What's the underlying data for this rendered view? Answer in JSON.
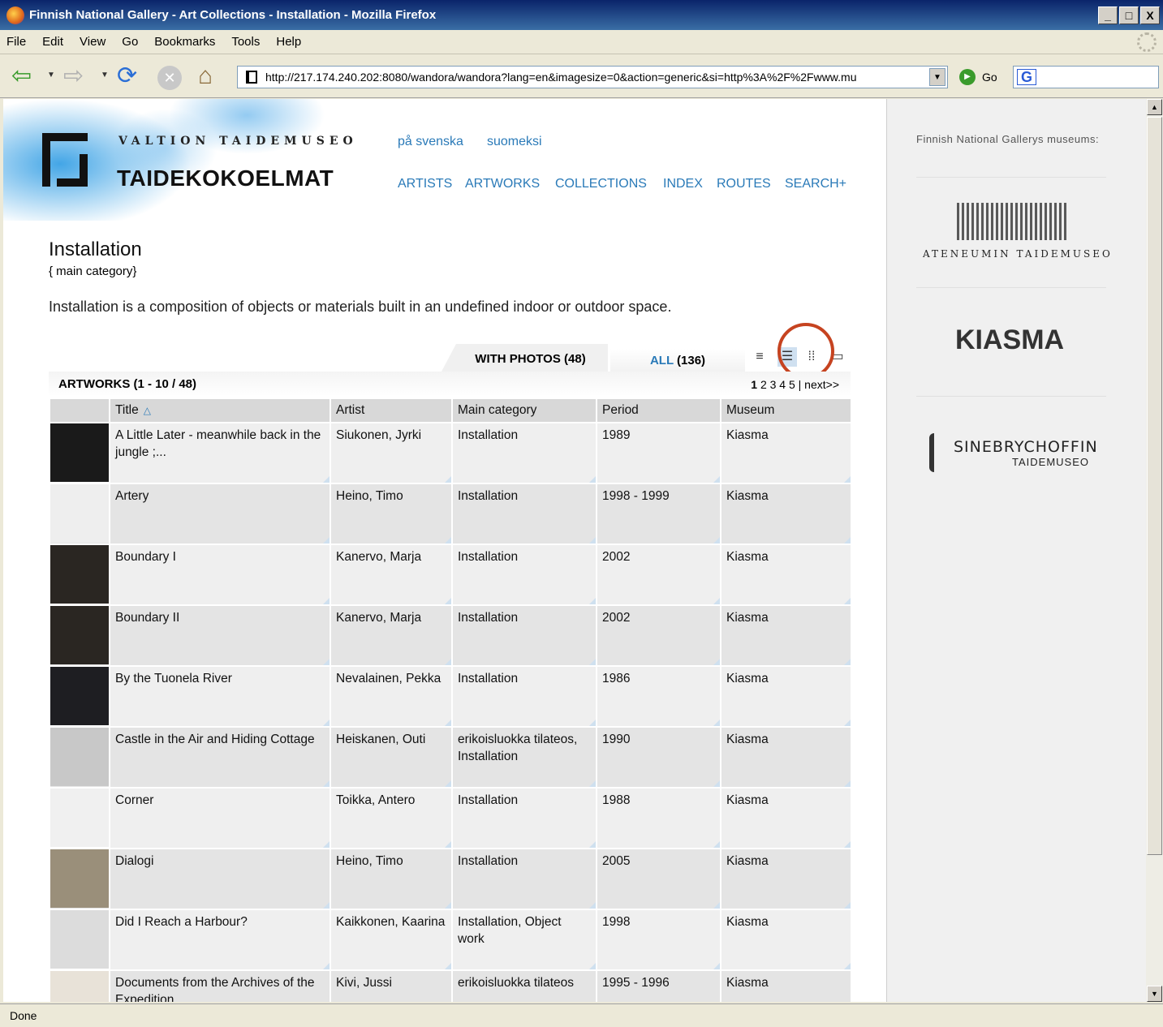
{
  "window": {
    "title": "Finnish National Gallery - Art Collections - Installation - Mozilla Firefox",
    "controls": [
      "_",
      "□",
      "X"
    ]
  },
  "menu": [
    "File",
    "Edit",
    "View",
    "Go",
    "Bookmarks",
    "Tools",
    "Help"
  ],
  "toolbar": {
    "url": "http://217.174.240.202:8080/wandora/wandora?lang=en&imagesize=0&action=generic&si=http%3A%2F%2Fwww.mu",
    "go_label": "Go",
    "search_logo": "G"
  },
  "site": {
    "subtitle": "VALTION TAIDEMUSEO",
    "title": "TAIDEKOKOELMAT",
    "languages": [
      "på svenska",
      "suomeksi"
    ],
    "nav": [
      "ARTISTS",
      "ARTWORKS",
      "COLLECTIONS",
      "INDEX",
      "ROUTES",
      "SEARCH+"
    ]
  },
  "page": {
    "title": "Installation",
    "subtitle": "{  main category}",
    "description": "Installation is a composition of objects or materials built in an undefined indoor or outdoor space."
  },
  "tabs": {
    "photos": "WITH PHOTOS (48)",
    "all_label": "ALL",
    "all_count": " (136)"
  },
  "list_header": {
    "label": "ARTWORKS (1 - 10 / 48)",
    "pager_current": "1",
    "pager_pages": " 2 3 4 5 | next>>"
  },
  "table": {
    "columns": [
      "Title",
      "Artist",
      "Main category",
      "Period",
      "Museum"
    ],
    "rows": [
      {
        "title": "A Little Later - meanwhile back in the jungle ;...",
        "artist": "Siukonen, Jyrki",
        "category": "Installation",
        "period": "1989",
        "museum": "Kiasma",
        "thumb": "#1a1a1a"
      },
      {
        "title": "Artery",
        "artist": "Heino, Timo",
        "category": "Installation",
        "period": "1998 - 1999",
        "museum": "Kiasma",
        "thumb": "#eeeeee"
      },
      {
        "title": "Boundary I",
        "artist": "Kanervo, Marja",
        "category": "Installation",
        "period": "2002",
        "museum": "Kiasma",
        "thumb": "#2a2622"
      },
      {
        "title": "Boundary II",
        "artist": "Kanervo, Marja",
        "category": "Installation",
        "period": "2002",
        "museum": "Kiasma",
        "thumb": "#2a2622"
      },
      {
        "title": "By the Tuonela River",
        "artist": "Nevalainen, Pekka",
        "category": "Installation",
        "period": "1986",
        "museum": "Kiasma",
        "thumb": "#1e1e22"
      },
      {
        "title": "Castle in the Air and Hiding Cottage",
        "artist": "Heiskanen, Outi",
        "category": "erikoisluokka tilateos, Installation",
        "period": "1990",
        "museum": "Kiasma",
        "thumb": "#c8c8c8"
      },
      {
        "title": "Corner",
        "artist": "Toikka, Antero",
        "category": "Installation",
        "period": "1988",
        "museum": "Kiasma",
        "thumb": "#f0f0f0"
      },
      {
        "title": "Dialogi",
        "artist": "Heino, Timo",
        "category": "Installation",
        "period": "2005",
        "museum": "Kiasma",
        "thumb": "#9a8f7a"
      },
      {
        "title": "Did I Reach a Harbour?",
        "artist": "Kaikkonen, Kaarina",
        "category": "Installation, Object work",
        "period": "1998",
        "museum": "Kiasma",
        "thumb": "#dcdcdc"
      },
      {
        "title": "Documents from the Archives of the Expedition",
        "artist": "Kivi, Jussi",
        "category": "erikoisluokka tilateos",
        "period": "1995 - 1996",
        "museum": "Kiasma",
        "thumb": "#e8e2d8"
      }
    ]
  },
  "sidebar": {
    "label": "Finnish National Gallerys museums:",
    "museums": [
      "ATENEUMIN TAIDEMUSEO",
      "KIASMA",
      "SINEBRYCHOFFIN",
      "TAIDEMUSEO"
    ]
  },
  "status": "Done",
  "colors": {
    "link": "#2a7ab8",
    "highlight": "#c64320"
  }
}
